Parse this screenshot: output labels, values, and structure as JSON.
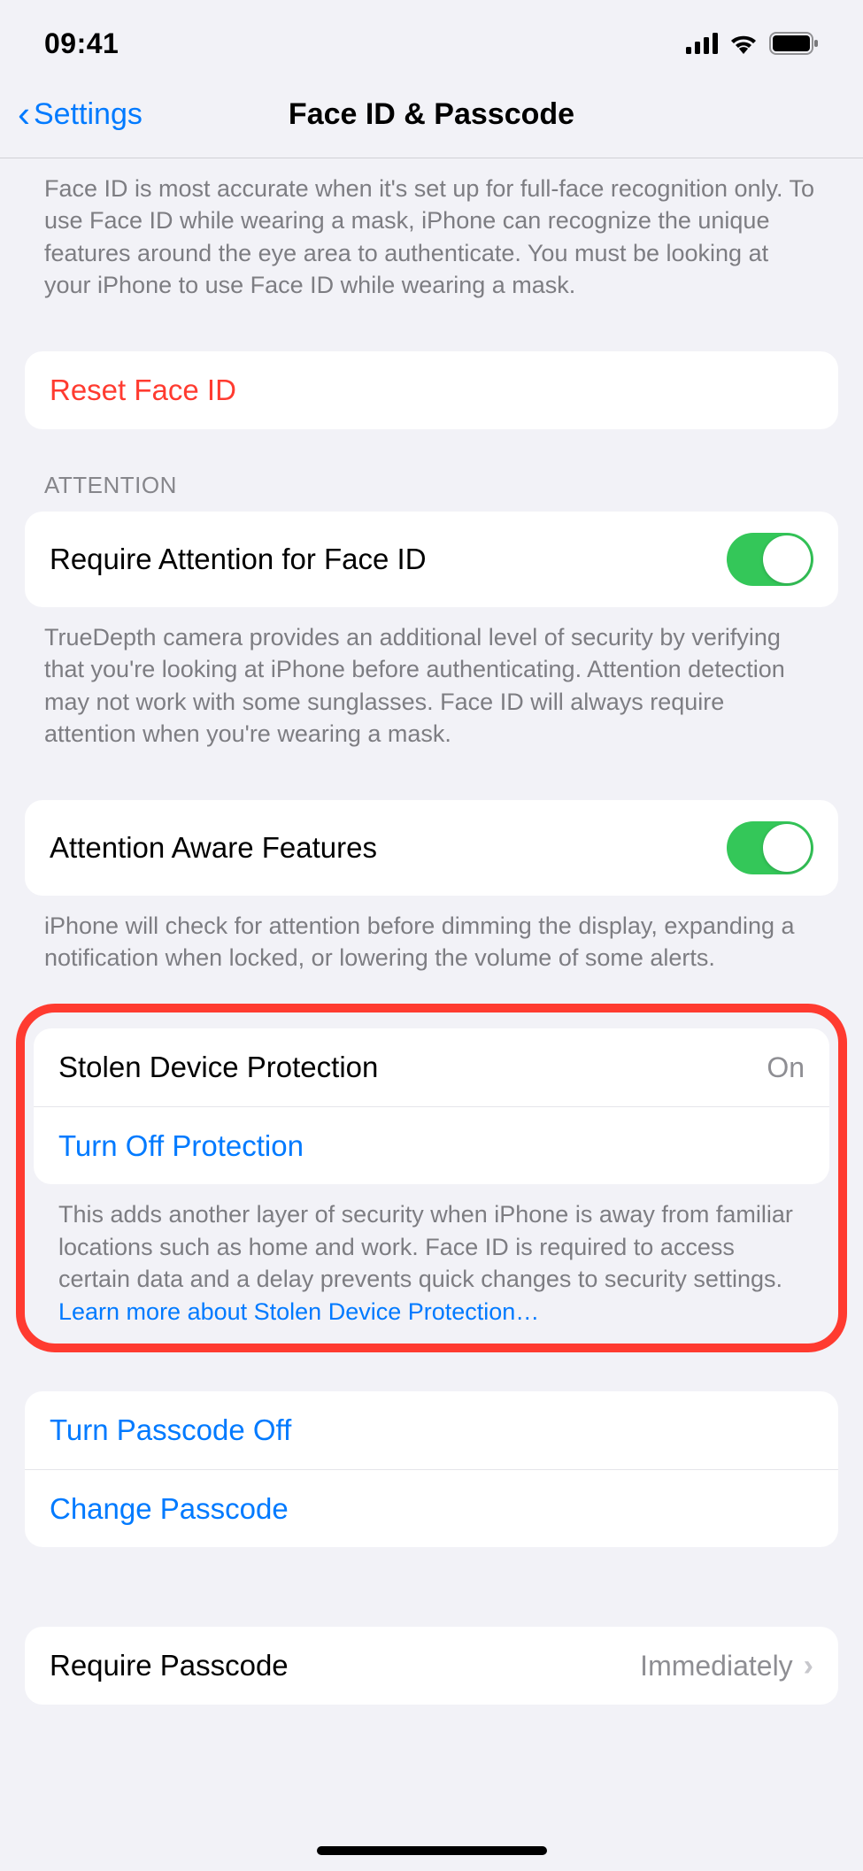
{
  "statusBar": {
    "time": "09:41"
  },
  "nav": {
    "back": "Settings",
    "title": "Face ID & Passcode"
  },
  "faceIdFooter": "Face ID is most accurate when it's set up for full-face recognition only. To use Face ID while wearing a mask, iPhone can recognize the unique features around the eye area to authenticate. You must be looking at your iPhone to use Face ID while wearing a mask.",
  "resetFaceId": "Reset Face ID",
  "attention": {
    "header": "ATTENTION",
    "requireAttention": "Require Attention for Face ID",
    "requireAttentionFooter": "TrueDepth camera provides an additional level of security by verifying that you're looking at iPhone before authenticating. Attention detection may not work with some sunglasses. Face ID will always require attention when you're wearing a mask.",
    "attentionAware": "Attention Aware Features",
    "attentionAwareFooter": "iPhone will check for attention before dimming the display, expanding a notification when locked, or lowering the volume of some alerts."
  },
  "stolenDevice": {
    "title": "Stolen Device Protection",
    "status": "On",
    "turnOff": "Turn Off Protection",
    "footer": "This adds another layer of security when iPhone is away from familiar locations such as home and work. Face ID is required to access certain data and a delay prevents quick changes to security settings. ",
    "learnMore": "Learn more about Stolen Device Protection…"
  },
  "passcode": {
    "turnOff": "Turn Passcode Off",
    "change": "Change Passcode",
    "require": "Require Passcode",
    "requireValue": "Immediately"
  }
}
